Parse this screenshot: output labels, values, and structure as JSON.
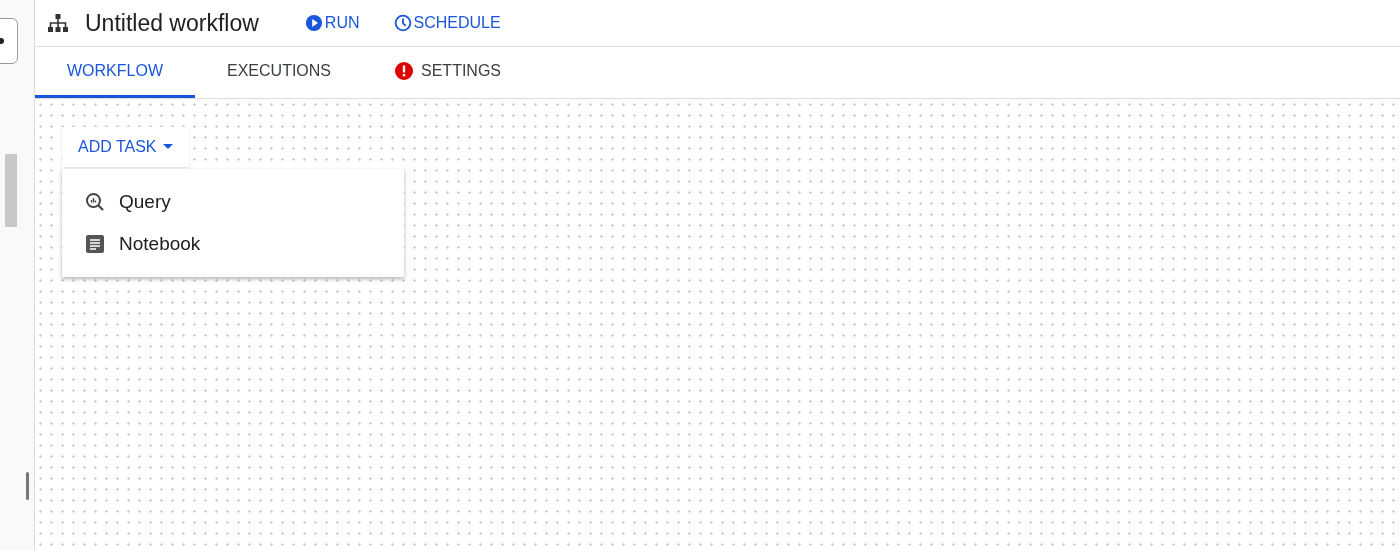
{
  "header": {
    "title": "Untitled workflow",
    "actions": [
      {
        "label": "RUN",
        "kind": "play"
      },
      {
        "label": "SCHEDULE",
        "kind": "clock"
      }
    ]
  },
  "tabs": [
    {
      "label": "WORKFLOW",
      "selected": true,
      "alert": false
    },
    {
      "label": "EXECUTIONS",
      "selected": false,
      "alert": false
    },
    {
      "label": "SETTINGS",
      "selected": false,
      "alert": true
    }
  ],
  "add_task": {
    "label": "ADD TASK",
    "expanded": true,
    "menu": [
      {
        "label": "Query",
        "kind": "query"
      },
      {
        "label": "Notebook",
        "kind": "notebook"
      }
    ]
  }
}
